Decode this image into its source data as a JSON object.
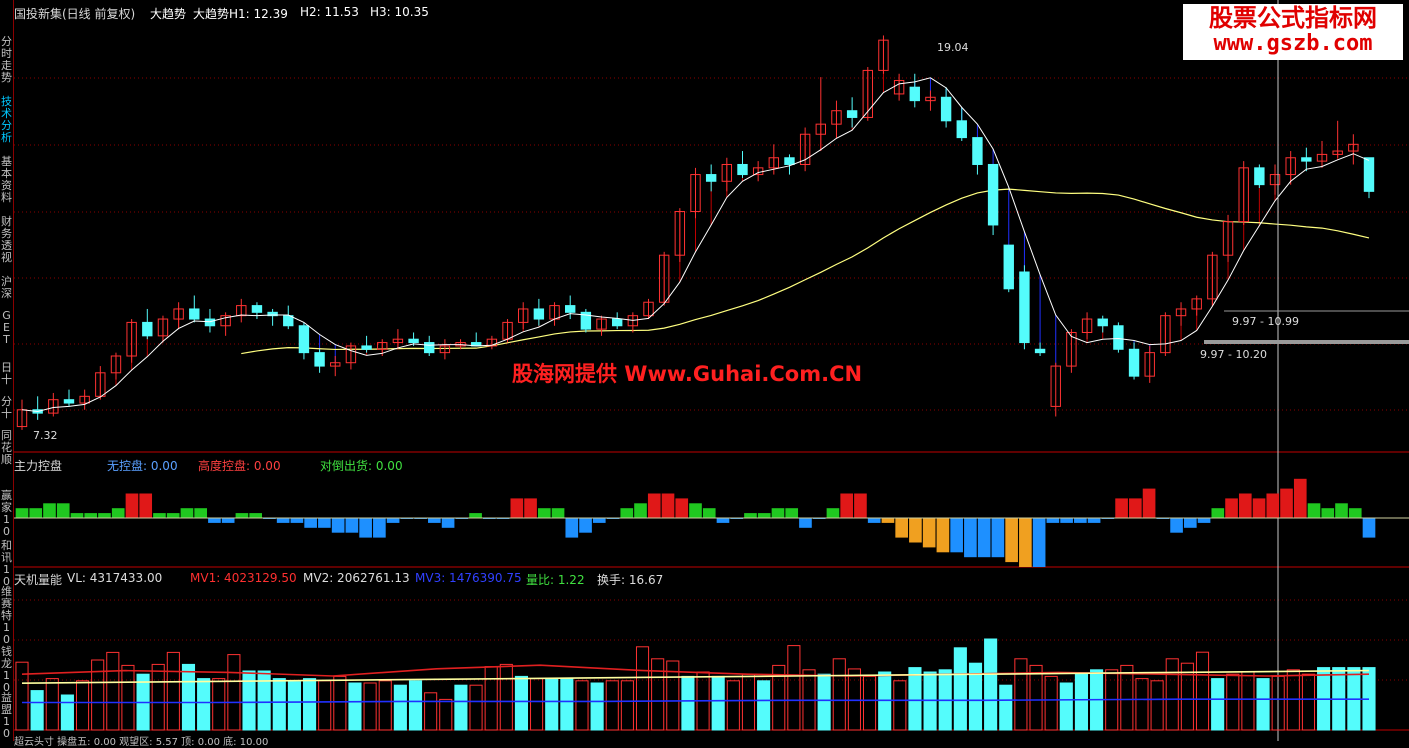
{
  "sidebar": {
    "items": [
      {
        "label": "分时走势",
        "top": 0
      },
      {
        "label": "技术分析",
        "active": true
      },
      {
        "label": "基本资料"
      },
      {
        "label": "财务透视"
      },
      {
        "label": "沪深"
      },
      {
        "label": "GET"
      },
      {
        "label": "日十"
      },
      {
        "label": "分十"
      },
      {
        "label": "同花顺"
      },
      {
        "label": "赢家10"
      },
      {
        "label": "和讯10"
      },
      {
        "label": "维赛特10"
      },
      {
        "label": "钱龙10"
      },
      {
        "label": "益盟10"
      }
    ]
  },
  "main_panel": {
    "title": "国投新集(日线 前复权)",
    "indicator": "大趋势",
    "h1": "大趋势H1: 12.39",
    "h2": "H2: 11.53",
    "h3": "H3: 10.35",
    "high_label": "19.04",
    "low_label": "7.32",
    "range_label_1": "9.97 - 10.99",
    "range_label_2": "9.97 - 10.20"
  },
  "control_panel": {
    "title": "主力控盘",
    "no_control": "无控盘: 0.00",
    "high_control": "高度控盘: 0.00",
    "sell_off": "对倒出货: 0.00"
  },
  "volume_panel": {
    "title": "天机量能",
    "vl": "VL: 4317433.00",
    "mv1": "MV1: 4023129.50",
    "mv2": "MV2: 2062761.13",
    "mv3": "MV3: 1476390.75",
    "ratio": "量比: 1.22",
    "turnover": "换手: 16.67"
  },
  "bottom_strip": {
    "text": "超云头寸  操盘五: 0.00  观望区: 5.57  顶: 0.00  底: 10.00"
  },
  "brand": {
    "line1": "股票公式指标网",
    "line2": "www.gszb.com"
  },
  "watermark": {
    "text": "股海网提供 Www.Guhai.Com.CN"
  },
  "colors": {
    "up": "#ff3232",
    "down": "#54fcfc",
    "ma": "#ffffff",
    "ma_long": "#ffff80",
    "hatch_up": "#c00000",
    "hatch_down": "#2030ff",
    "grid": "#8a0000"
  },
  "chart_data": [
    {
      "type": "candlestick",
      "title": "国投新集(日线 前复权)",
      "ylim": [
        7,
        19.5
      ],
      "candles": [
        {
          "o": 7.4,
          "h": 8.2,
          "l": 7.3,
          "c": 7.9
        },
        {
          "o": 7.9,
          "h": 8.3,
          "l": 7.6,
          "c": 7.8
        },
        {
          "o": 7.8,
          "h": 8.4,
          "l": 7.7,
          "c": 8.2
        },
        {
          "o": 8.2,
          "h": 8.5,
          "l": 8.0,
          "c": 8.1
        },
        {
          "o": 8.1,
          "h": 8.5,
          "l": 7.9,
          "c": 8.3
        },
        {
          "o": 8.3,
          "h": 9.2,
          "l": 8.2,
          "c": 9.0
        },
        {
          "o": 9.0,
          "h": 9.6,
          "l": 8.8,
          "c": 9.5
        },
        {
          "o": 9.5,
          "h": 10.6,
          "l": 9.3,
          "c": 10.5
        },
        {
          "o": 10.5,
          "h": 10.9,
          "l": 10.0,
          "c": 10.1
        },
        {
          "o": 10.1,
          "h": 10.7,
          "l": 9.9,
          "c": 10.6
        },
        {
          "o": 10.6,
          "h": 11.1,
          "l": 10.3,
          "c": 10.9
        },
        {
          "o": 10.9,
          "h": 11.3,
          "l": 10.5,
          "c": 10.6
        },
        {
          "o": 10.6,
          "h": 10.9,
          "l": 10.2,
          "c": 10.4
        },
        {
          "o": 10.4,
          "h": 10.8,
          "l": 10.1,
          "c": 10.7
        },
        {
          "o": 10.7,
          "h": 11.2,
          "l": 10.5,
          "c": 11.0
        },
        {
          "o": 11.0,
          "h": 11.1,
          "l": 10.6,
          "c": 10.8
        },
        {
          "o": 10.8,
          "h": 10.9,
          "l": 10.4,
          "c": 10.7
        },
        {
          "o": 10.7,
          "h": 11.0,
          "l": 10.3,
          "c": 10.4
        },
        {
          "o": 10.4,
          "h": 10.5,
          "l": 9.4,
          "c": 9.6
        },
        {
          "o": 9.6,
          "h": 9.7,
          "l": 9.0,
          "c": 9.2
        },
        {
          "o": 9.2,
          "h": 9.5,
          "l": 8.9,
          "c": 9.3
        },
        {
          "o": 9.3,
          "h": 9.9,
          "l": 9.1,
          "c": 9.8
        },
        {
          "o": 9.8,
          "h": 10.1,
          "l": 9.6,
          "c": 9.7
        },
        {
          "o": 9.7,
          "h": 10.0,
          "l": 9.5,
          "c": 9.9
        },
        {
          "o": 9.9,
          "h": 10.3,
          "l": 9.7,
          "c": 10.0
        },
        {
          "o": 10.0,
          "h": 10.2,
          "l": 9.8,
          "c": 9.9
        },
        {
          "o": 9.9,
          "h": 10.1,
          "l": 9.5,
          "c": 9.6
        },
        {
          "o": 9.6,
          "h": 10.0,
          "l": 9.4,
          "c": 9.8
        },
        {
          "o": 9.8,
          "h": 10.0,
          "l": 9.7,
          "c": 9.9
        },
        {
          "o": 9.9,
          "h": 10.2,
          "l": 9.8,
          "c": 9.8
        },
        {
          "o": 9.8,
          "h": 10.1,
          "l": 9.7,
          "c": 10.0
        },
        {
          "o": 10.0,
          "h": 10.6,
          "l": 9.9,
          "c": 10.5
        },
        {
          "o": 10.5,
          "h": 11.1,
          "l": 10.3,
          "c": 10.9
        },
        {
          "o": 10.9,
          "h": 11.2,
          "l": 10.4,
          "c": 10.6
        },
        {
          "o": 10.6,
          "h": 11.1,
          "l": 10.4,
          "c": 11.0
        },
        {
          "o": 11.0,
          "h": 11.3,
          "l": 10.6,
          "c": 10.8
        },
        {
          "o": 10.8,
          "h": 10.9,
          "l": 10.2,
          "c": 10.3
        },
        {
          "o": 10.3,
          "h": 10.7,
          "l": 10.1,
          "c": 10.6
        },
        {
          "o": 10.6,
          "h": 10.8,
          "l": 10.3,
          "c": 10.4
        },
        {
          "o": 10.4,
          "h": 10.8,
          "l": 10.2,
          "c": 10.7
        },
        {
          "o": 10.7,
          "h": 11.2,
          "l": 10.6,
          "c": 11.1
        },
        {
          "o": 11.1,
          "h": 12.6,
          "l": 11.0,
          "c": 12.5
        },
        {
          "o": 12.5,
          "h": 13.9,
          "l": 12.3,
          "c": 13.8
        },
        {
          "o": 13.8,
          "h": 15.1,
          "l": 13.6,
          "c": 14.9
        },
        {
          "o": 14.9,
          "h": 15.2,
          "l": 14.4,
          "c": 14.7
        },
        {
          "o": 14.7,
          "h": 15.4,
          "l": 14.4,
          "c": 15.2
        },
        {
          "o": 15.2,
          "h": 15.6,
          "l": 14.8,
          "c": 14.9
        },
        {
          "o": 14.9,
          "h": 15.3,
          "l": 14.7,
          "c": 15.1
        },
        {
          "o": 15.1,
          "h": 15.8,
          "l": 14.9,
          "c": 15.4
        },
        {
          "o": 15.4,
          "h": 15.5,
          "l": 14.9,
          "c": 15.2
        },
        {
          "o": 15.2,
          "h": 16.3,
          "l": 15.0,
          "c": 16.1
        },
        {
          "o": 16.1,
          "h": 17.8,
          "l": 15.6,
          "c": 16.4
        },
        {
          "o": 16.4,
          "h": 17.1,
          "l": 16.0,
          "c": 16.8
        },
        {
          "o": 16.8,
          "h": 17.2,
          "l": 16.3,
          "c": 16.6
        },
        {
          "o": 16.6,
          "h": 18.1,
          "l": 16.5,
          "c": 18.0
        },
        {
          "o": 18.0,
          "h": 19.04,
          "l": 17.9,
          "c": 18.9
        },
        {
          "o": 17.3,
          "h": 17.9,
          "l": 17.1,
          "c": 17.7
        },
        {
          "o": 17.5,
          "h": 17.9,
          "l": 16.9,
          "c": 17.1
        },
        {
          "o": 17.1,
          "h": 17.4,
          "l": 16.8,
          "c": 17.2
        },
        {
          "o": 17.2,
          "h": 17.5,
          "l": 16.3,
          "c": 16.5
        },
        {
          "o": 16.5,
          "h": 16.9,
          "l": 15.9,
          "c": 16.0
        },
        {
          "o": 16.0,
          "h": 16.0,
          "l": 14.9,
          "c": 15.2
        },
        {
          "o": 15.2,
          "h": 15.2,
          "l": 13.1,
          "c": 13.4
        },
        {
          "o": 12.8,
          "h": 12.8,
          "l": 11.4,
          "c": 11.5
        },
        {
          "o": 12.0,
          "h": 12.2,
          "l": 9.7,
          "c": 9.9
        },
        {
          "o": 9.7,
          "h": 9.9,
          "l": 9.5,
          "c": 9.6
        },
        {
          "o": 8.0,
          "h": 9.3,
          "l": 7.7,
          "c": 9.2
        },
        {
          "o": 9.2,
          "h": 10.3,
          "l": 9.0,
          "c": 10.2
        },
        {
          "o": 10.2,
          "h": 10.8,
          "l": 10.0,
          "c": 10.6
        },
        {
          "o": 10.6,
          "h": 10.7,
          "l": 10.2,
          "c": 10.4
        },
        {
          "o": 10.4,
          "h": 10.5,
          "l": 9.6,
          "c": 9.7
        },
        {
          "o": 9.7,
          "h": 9.9,
          "l": 8.8,
          "c": 8.9
        },
        {
          "o": 8.9,
          "h": 9.8,
          "l": 8.7,
          "c": 9.6
        },
        {
          "o": 9.6,
          "h": 10.8,
          "l": 9.5,
          "c": 10.7
        },
        {
          "o": 10.7,
          "h": 11.1,
          "l": 10.4,
          "c": 10.9
        },
        {
          "o": 10.9,
          "h": 11.3,
          "l": 10.7,
          "c": 11.2
        },
        {
          "o": 11.2,
          "h": 12.6,
          "l": 11.0,
          "c": 12.5
        },
        {
          "o": 12.5,
          "h": 13.7,
          "l": 12.3,
          "c": 13.5
        },
        {
          "o": 13.5,
          "h": 15.3,
          "l": 13.4,
          "c": 15.1
        },
        {
          "o": 15.1,
          "h": 15.2,
          "l": 14.5,
          "c": 14.6
        },
        {
          "o": 14.6,
          "h": 15.2,
          "l": 14.3,
          "c": 14.9
        },
        {
          "o": 14.9,
          "h": 15.6,
          "l": 14.6,
          "c": 15.4
        },
        {
          "o": 15.4,
          "h": 15.7,
          "l": 15.0,
          "c": 15.3
        },
        {
          "o": 15.3,
          "h": 15.9,
          "l": 15.1,
          "c": 15.5
        },
        {
          "o": 15.5,
          "h": 16.5,
          "l": 15.4,
          "c": 15.6
        },
        {
          "o": 15.6,
          "h": 16.1,
          "l": 15.2,
          "c": 15.8
        },
        {
          "o": 15.4,
          "h": 15.4,
          "l": 14.2,
          "c": 14.4
        }
      ]
    },
    {
      "type": "bar",
      "title": "主力控盘",
      "values": [
        2,
        2,
        3,
        3,
        1,
        1,
        1,
        2,
        5,
        5,
        1,
        1,
        2,
        2,
        -1,
        -1,
        1,
        1,
        0,
        -1,
        -1,
        -2,
        -2,
        -3,
        -3,
        -4,
        -4,
        -1,
        0,
        0,
        -1,
        -2,
        0,
        1,
        0,
        0,
        4,
        4,
        2,
        2,
        -4,
        -3,
        -1,
        0,
        2,
        3,
        5,
        5,
        4,
        3,
        2,
        -1,
        0,
        1,
        1,
        2,
        2,
        -2,
        0,
        2,
        5,
        5,
        -1,
        -1,
        -4,
        -5,
        -6,
        -7,
        -7,
        -8,
        -8,
        -8,
        -9,
        -10,
        -10,
        -1,
        -1,
        -1,
        -1,
        0,
        4,
        4,
        6,
        0,
        -3,
        -2,
        -1,
        2,
        4,
        5,
        4,
        5,
        6,
        8,
        3,
        2,
        3,
        2,
        -4
      ],
      "orange_indices": [
        63,
        64,
        65,
        66,
        67,
        72,
        73
      ]
    },
    {
      "type": "bar",
      "title": "天机量能",
      "values": [
        4,
        2,
        3,
        2,
        3,
        4,
        5,
        3,
        3,
        4,
        5,
        4,
        3,
        3,
        5,
        4,
        4,
        3,
        2,
        3,
        3,
        3,
        3,
        3,
        3,
        3,
        3,
        2,
        2,
        3,
        3,
        4,
        4,
        3,
        3,
        3,
        3,
        3,
        3,
        3,
        3,
        4,
        3,
        3,
        3,
        3,
        3,
        3,
        3,
        3,
        3,
        3,
        3,
        3,
        3,
        3,
        3,
        3,
        3,
        3,
        3,
        3,
        3,
        3,
        3,
        3,
        3,
        3,
        3,
        3,
        3,
        3,
        3,
        3,
        3,
        3,
        3,
        3,
        3,
        3,
        3,
        3,
        3,
        3,
        3,
        3,
        3,
        3,
        3,
        3
      ],
      "ma1": [
        3.1,
        3.3,
        3.2,
        3.0,
        3.4,
        3.6,
        3.3,
        3.1,
        3.0,
        3.1,
        3.2,
        3.1,
        3.0,
        3.1
      ],
      "ma2": [
        2.6,
        2.7,
        2.8,
        2.9,
        3.0,
        3.1,
        3.2,
        3.3
      ],
      "ma3": [
        2.5,
        2.5,
        2.6,
        2.6,
        2.7,
        2.7,
        2.8,
        2.8
      ]
    }
  ]
}
